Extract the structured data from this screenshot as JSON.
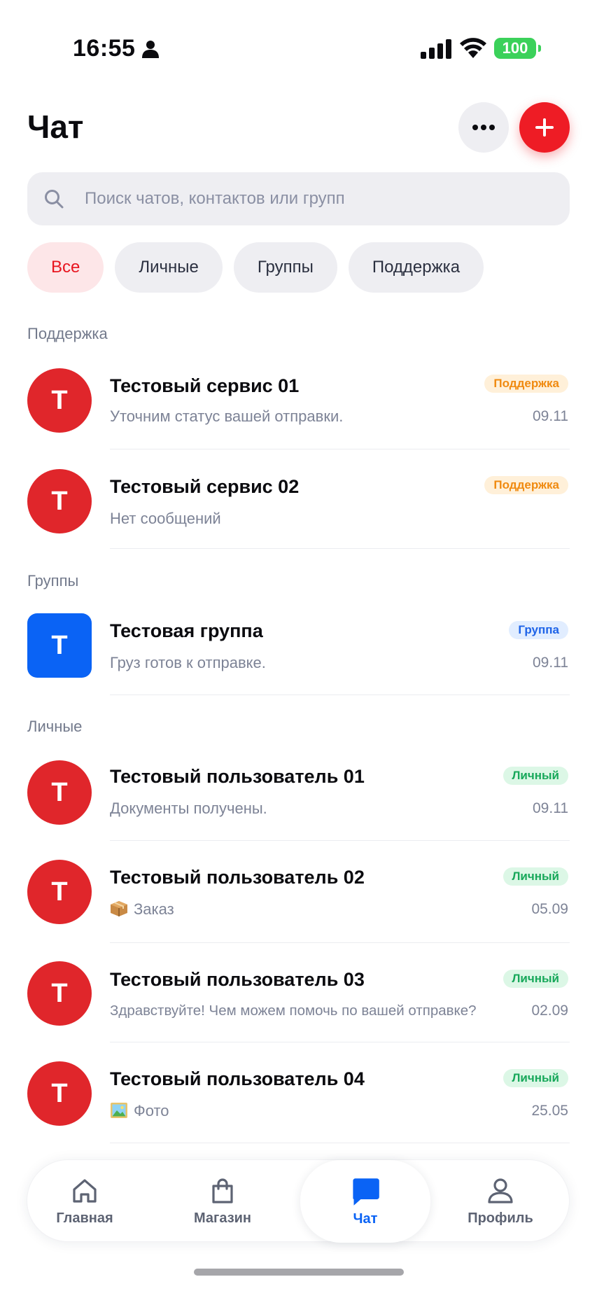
{
  "status_bar": {
    "time": "16:55",
    "battery": "100"
  },
  "header": {
    "title": "Чат"
  },
  "search": {
    "placeholder": "Поиск чатов, контактов или групп"
  },
  "filters": [
    {
      "label": "Все",
      "active": true
    },
    {
      "label": "Личные",
      "active": false
    },
    {
      "label": "Группы",
      "active": false
    },
    {
      "label": "Поддержка",
      "active": false
    }
  ],
  "sections": [
    {
      "title": "Поддержка",
      "chats": [
        {
          "avatar": "Т",
          "name": "Тестовый сервис 01",
          "preview": "Уточним статус вашей отправки.",
          "badge": "Поддержка",
          "date": "09.11"
        },
        {
          "avatar": "Т",
          "name": "Тестовый сервис 02",
          "preview": "Нет сообщений",
          "badge": "Поддержка",
          "date": ""
        }
      ]
    },
    {
      "title": "Группы",
      "chats": [
        {
          "avatar": "Т",
          "name": "Тестовая группа",
          "preview": "Груз готов к отправке.",
          "badge": "Группа",
          "date": "09.11"
        }
      ]
    },
    {
      "title": "Личные",
      "chats": [
        {
          "avatar": "Т",
          "name": "Тестовый пользователь 01",
          "preview": "Документы получены.",
          "badge": "Личный",
          "date": "09.11"
        },
        {
          "avatar": "Т",
          "name": "Тестовый пользователь 02",
          "preview": "Заказ",
          "preview_icon": "package-icon",
          "badge": "Личный",
          "date": "05.09"
        },
        {
          "avatar": "Т",
          "name": "Тестовый пользователь 03",
          "preview": "Здравствуйте! Чем можем помочь по вашей отправке?",
          "badge": "Личный",
          "date": "02.09"
        },
        {
          "avatar": "Т",
          "name": "Тестовый пользователь 04",
          "preview": "Фото",
          "preview_icon": "photo-icon",
          "badge": "Личный",
          "date": "25.05"
        }
      ]
    }
  ],
  "bottom_nav": [
    {
      "label": "Главная",
      "icon": "home-icon",
      "active": false
    },
    {
      "label": "Магазин",
      "icon": "shopping-bag-icon",
      "active": false
    },
    {
      "label": "Чат",
      "icon": "chat-bubble-icon",
      "active": true
    },
    {
      "label": "Профиль",
      "icon": "profile-icon",
      "active": false
    }
  ],
  "colors": {
    "accent_red": "#ee1c25",
    "active_blue": "#0a63f5",
    "battery_green": "#3bd15a"
  }
}
